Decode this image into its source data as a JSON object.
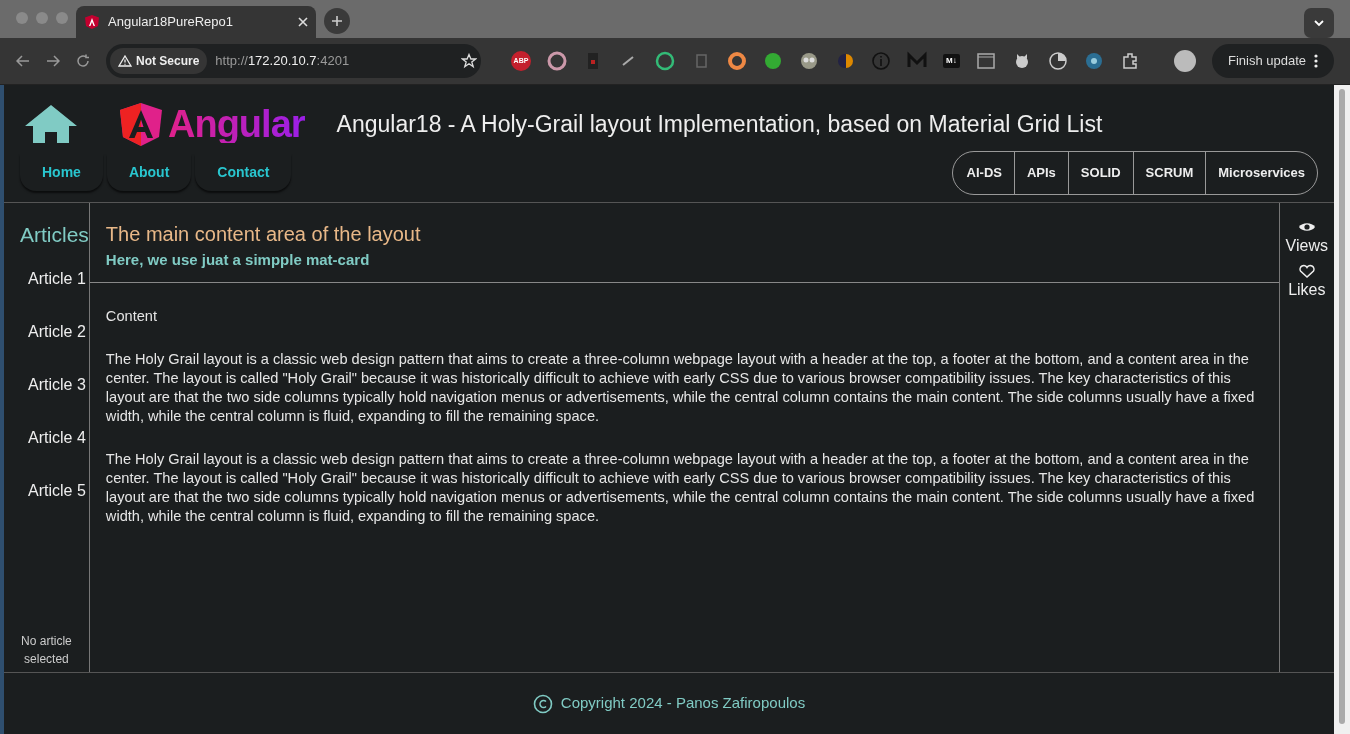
{
  "browser": {
    "tab_title": "Angular18PureRepo1",
    "security": "Not Secure",
    "url": {
      "scheme": "http://",
      "host": "172.20.10.7",
      "port": ":4201"
    },
    "extension_labels": [
      "ABP",
      "M↓"
    ],
    "update_button": "Finish update"
  },
  "header": {
    "logo_text": "Angular",
    "title": "Angular18 - A Holy-Grail layout Implementation, based on Material Grid List",
    "nav": [
      {
        "label": "Home"
      },
      {
        "label": "About"
      },
      {
        "label": "Contact"
      }
    ],
    "topics": [
      {
        "label": "AI-DS"
      },
      {
        "label": "APIs"
      },
      {
        "label": "SOLID"
      },
      {
        "label": "SCRUM"
      },
      {
        "label": "Microservices"
      }
    ]
  },
  "sidebar": {
    "title": "Articles",
    "items": [
      {
        "label": "Article 1"
      },
      {
        "label": "Article 2"
      },
      {
        "label": "Article 3"
      },
      {
        "label": "Article 4"
      },
      {
        "label": "Article 5"
      }
    ],
    "status": "No article selected"
  },
  "main": {
    "title": "The main content area of the layout",
    "subtitle": "Here, we use juat a simpple mat-card",
    "content_label": "Content",
    "paragraphs": [
      "The Holy Grail layout is a classic web design pattern that aims to create a three-column webpage layout with a header at the top, a footer at the bottom, and a content area in the center. The layout is called \"Holy Grail\" because it was historically difficult to achieve with early CSS due to various browser compatibility issues. The key characteristics of this layout are that the two side columns typically hold navigation menus or advertisements, while the central column contains the main content. The side columns usually have a fixed width, while the central column is fluid, expanding to fill the remaining space.",
      "The Holy Grail layout is a classic web design pattern that aims to create a three-column webpage layout with a header at the top, a footer at the bottom, and a content area in the center. The layout is called \"Holy Grail\" because it was historically difficult to achieve with early CSS due to various browser compatibility issues. The key characteristics of this layout are that the two side columns typically hold navigation menus or advertisements, while the central column contains the main content. The side columns usually have a fixed width, while the central column is fluid, expanding to fill the remaining space."
    ]
  },
  "aside": {
    "items": [
      {
        "kind": "views",
        "label": "Views"
      },
      {
        "kind": "likes",
        "label": "Likes"
      }
    ]
  },
  "footer": {
    "text": "Copyright 2024 - Panos Zafiropoulos"
  }
}
